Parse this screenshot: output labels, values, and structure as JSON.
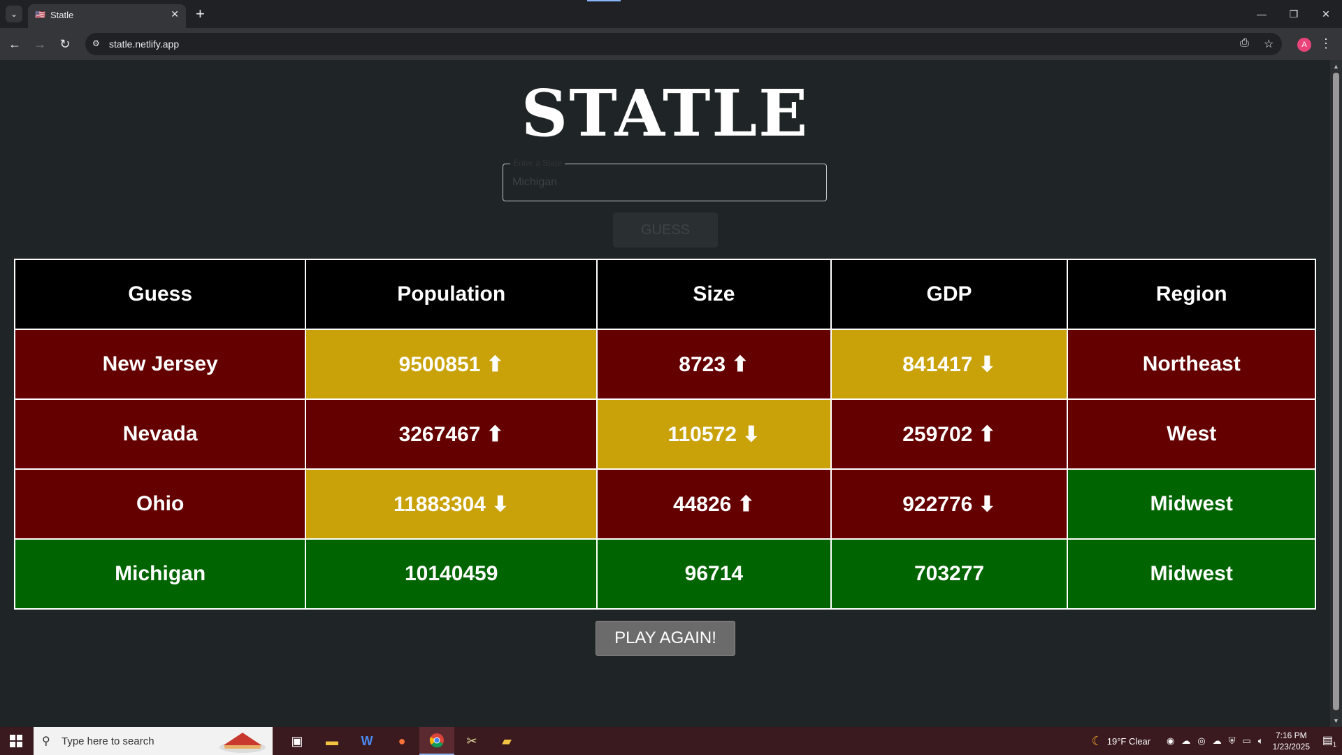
{
  "browser": {
    "tab_title": "Statle",
    "tab_favicon": "🇺🇸",
    "url": "statle.netlify.app",
    "profile_initial": "A"
  },
  "page": {
    "title": "STATLE",
    "input_label": "Enter a State",
    "input_value": "Michigan",
    "guess_label": "GUESS",
    "play_again_label": "PLAY AGAIN!"
  },
  "table": {
    "headers": [
      "Guess",
      "Population",
      "Size",
      "GDP",
      "Region"
    ],
    "rows": [
      {
        "cells": [
          {
            "text": "New Jersey",
            "color": "red"
          },
          {
            "text": "9500851 ⬆",
            "color": "yellow"
          },
          {
            "text": "8723 ⬆",
            "color": "red"
          },
          {
            "text": "841417 ⬇",
            "color": "yellow"
          },
          {
            "text": "Northeast",
            "color": "red"
          }
        ]
      },
      {
        "cells": [
          {
            "text": "Nevada",
            "color": "red"
          },
          {
            "text": "3267467 ⬆",
            "color": "red"
          },
          {
            "text": "110572 ⬇",
            "color": "yellow"
          },
          {
            "text": "259702 ⬆",
            "color": "red"
          },
          {
            "text": "West",
            "color": "red"
          }
        ]
      },
      {
        "cells": [
          {
            "text": "Ohio",
            "color": "red"
          },
          {
            "text": "11883304 ⬇",
            "color": "yellow"
          },
          {
            "text": "44826 ⬆",
            "color": "red"
          },
          {
            "text": "922776 ⬇",
            "color": "red"
          },
          {
            "text": "Midwest",
            "color": "green"
          }
        ]
      },
      {
        "cells": [
          {
            "text": "Michigan",
            "color": "green"
          },
          {
            "text": "10140459",
            "color": "green"
          },
          {
            "text": "96714",
            "color": "green"
          },
          {
            "text": "703277",
            "color": "green"
          },
          {
            "text": "Midwest",
            "color": "green"
          }
        ]
      }
    ]
  },
  "colors": {
    "red": "#640000",
    "yellow": "#c9a20a",
    "green": "#006400"
  },
  "taskbar": {
    "search_placeholder": "Type here to search",
    "weather": "19°F  Clear",
    "time": "7:16 PM",
    "date": "1/23/2025",
    "notification_count": "1"
  }
}
